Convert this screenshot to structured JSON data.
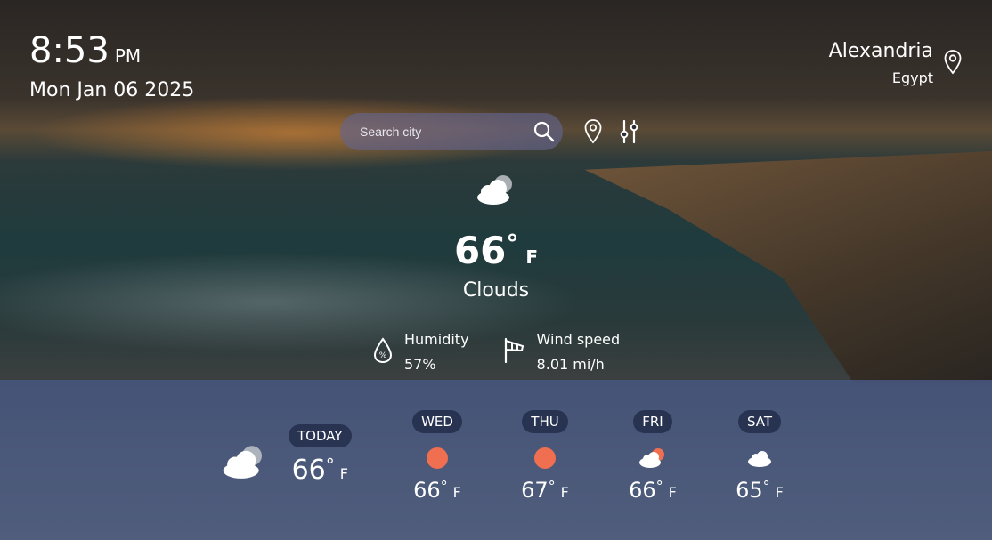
{
  "clock": {
    "time": "8:53",
    "ampm": "PM",
    "date": "Mon Jan 06 2025"
  },
  "location": {
    "city": "Alexandria",
    "country": "Egypt",
    "icon": "map-pin-icon"
  },
  "search": {
    "placeholder": "Search city",
    "icon": "search-icon"
  },
  "toolbar": {
    "locate_icon": "map-pin-icon",
    "settings_icon": "sliders-icon"
  },
  "current": {
    "icon": "cloud-icon",
    "temp": "66",
    "deg": "°",
    "unit": "F",
    "condition": "Clouds"
  },
  "stats": {
    "humidity": {
      "label": "Humidity",
      "value": "57%",
      "icon": "humidity-drop-icon"
    },
    "wind": {
      "label": "Wind speed",
      "value": "8.01 mi/h",
      "icon": "windsock-icon"
    }
  },
  "forecast": {
    "today": {
      "label": "TODAY",
      "temp": "66",
      "unit": "F",
      "icon": "cloud-icon"
    },
    "days": [
      {
        "label": "WED",
        "temp": "66",
        "unit": "F",
        "icon": "sun-icon"
      },
      {
        "label": "THU",
        "temp": "67",
        "unit": "F",
        "icon": "sun-icon"
      },
      {
        "label": "FRI",
        "temp": "66",
        "unit": "F",
        "icon": "partly-cloudy-icon"
      },
      {
        "label": "SAT",
        "temp": "65",
        "unit": "F",
        "icon": "cloud-icon"
      }
    ]
  },
  "colors": {
    "sun": "#ef6f50",
    "panel": "#46557d",
    "search_bg": "#64648c"
  }
}
